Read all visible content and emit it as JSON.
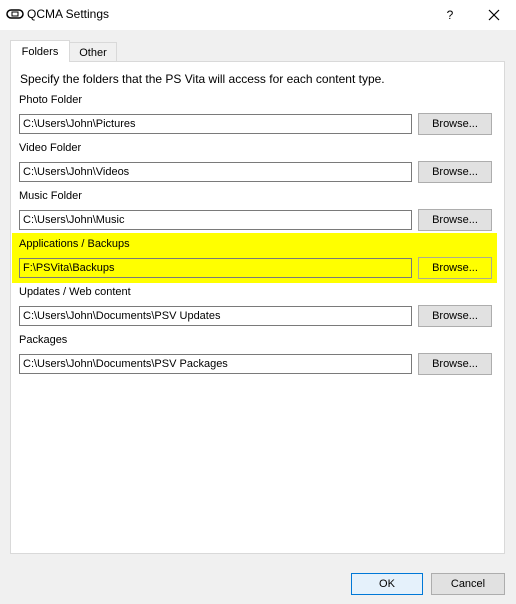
{
  "window": {
    "title": "QCMA Settings",
    "help_label": "?",
    "app_icon": "vita-controller-icon",
    "close_icon": "close-icon"
  },
  "tabs": [
    {
      "label": "Folders",
      "active": true
    },
    {
      "label": "Other",
      "active": false
    }
  ],
  "instructions": "Specify the folders that the PS Vita will access for each content type.",
  "fields": [
    {
      "label": "Photo Folder",
      "value": "C:\\Users\\John\\Pictures",
      "button": "Browse...",
      "highlighted": false
    },
    {
      "label": "Video Folder",
      "value": "C:\\Users\\John\\Videos",
      "button": "Browse...",
      "highlighted": false
    },
    {
      "label": "Music Folder",
      "value": "C:\\Users\\John\\Music",
      "button": "Browse...",
      "highlighted": false
    },
    {
      "label": "Applications / Backups",
      "value": "F:\\PSVita\\Backups",
      "button": "Browse...",
      "highlighted": true
    },
    {
      "label": "Updates / Web content",
      "value": "C:\\Users\\John\\Documents\\PSV Updates",
      "button": "Browse...",
      "highlighted": false
    },
    {
      "label": "Packages",
      "value": "C:\\Users\\John\\Documents\\PSV Packages",
      "button": "Browse...",
      "highlighted": false
    }
  ],
  "footer": {
    "ok_label": "OK",
    "cancel_label": "Cancel"
  },
  "colors": {
    "highlight": "#ffff00",
    "accent": "#0078d7"
  }
}
